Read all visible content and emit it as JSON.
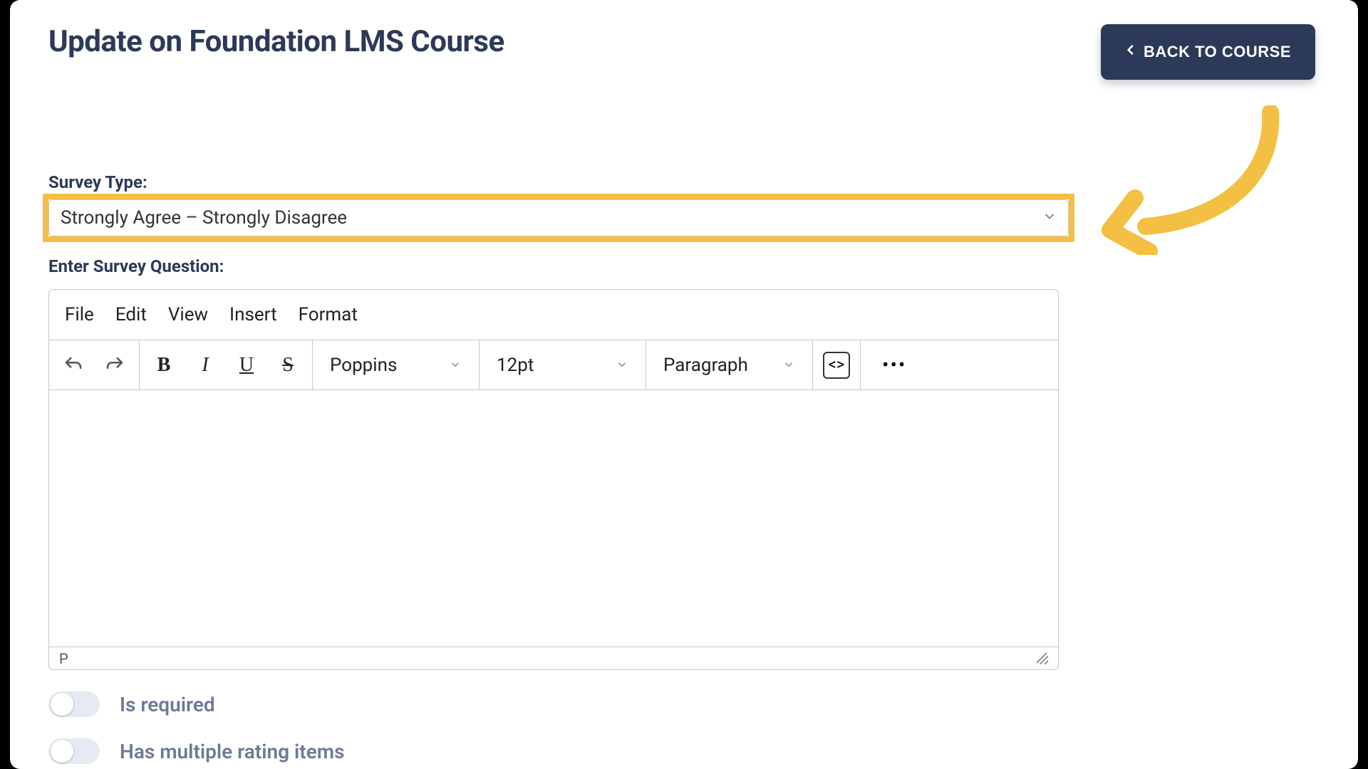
{
  "header": {
    "title": "Update on Foundation LMS Course",
    "back_label": "BACK TO COURSE"
  },
  "form": {
    "survey_type_label": "Survey Type:",
    "survey_type_value": "Strongly Agree – Strongly Disagree",
    "question_label": "Enter Survey Question:"
  },
  "editor": {
    "menus": {
      "file": "File",
      "edit": "Edit",
      "view": "View",
      "insert": "Insert",
      "format": "Format"
    },
    "font_family": "Poppins",
    "font_size": "12pt",
    "block_format": "Paragraph",
    "status_path": "P"
  },
  "toggles": {
    "is_required_label": "Is required",
    "multi_items_label": "Has multiple rating items"
  },
  "colors": {
    "accent": "#f3c043",
    "brand_dark": "#2d3958"
  }
}
